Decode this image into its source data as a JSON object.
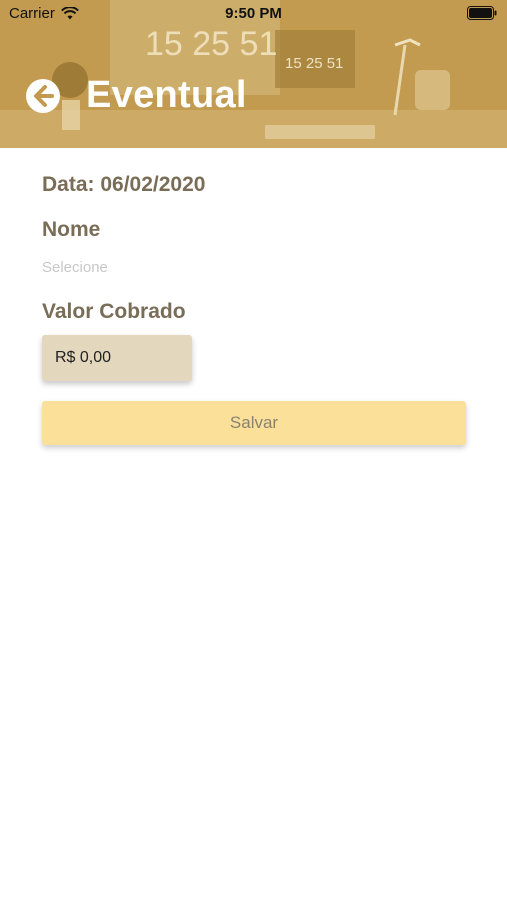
{
  "status_bar": {
    "carrier": "Carrier",
    "time": "9:50 PM"
  },
  "header": {
    "title": "Eventual",
    "background_tint": "#c19a4f",
    "photo_clock_big": "15 25 51",
    "photo_clock_small": "15 25 51"
  },
  "form": {
    "date_label": "Data: 06/02/2020",
    "name_label": "Nome",
    "name_placeholder": "Selecione",
    "valor_label": "Valor Cobrado",
    "valor_value": "R$ 0,00",
    "save_label": "Salvar"
  },
  "colors": {
    "label_text": "#7a6d58",
    "input_bg": "#e3d7bd",
    "button_bg": "#fbe09a",
    "button_text": "#8a826f"
  }
}
